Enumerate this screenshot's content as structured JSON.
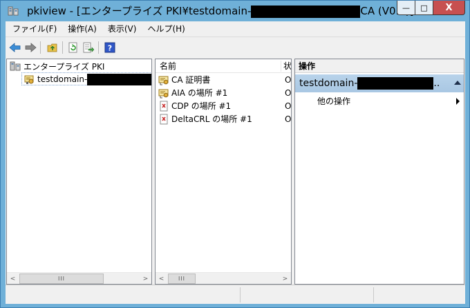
{
  "window": {
    "title_prefix": "pkiview - [エンタープライズ PKI¥testdomain-",
    "title_suffix": "CA (V0.0)]",
    "minimize_glyph": "—",
    "maximize_glyph": "□",
    "close_glyph": "X"
  },
  "menu": {
    "items": [
      "ファイル(F)",
      "操作(A)",
      "表示(V)",
      "ヘルプ(H)"
    ]
  },
  "tree": {
    "root_label": "エンタープライズ PKI",
    "child_label": "testdomain-"
  },
  "list": {
    "col_name": "名前",
    "col_status": "状",
    "rows": [
      {
        "name": "CA 証明書",
        "status": "O",
        "icon": "ca-certificate-icon"
      },
      {
        "name": "AIA の場所 #1",
        "status": "O",
        "icon": "ca-certificate-icon"
      },
      {
        "name": "CDP の場所 #1",
        "status": "O",
        "icon": "crl-icon"
      },
      {
        "name": "DeltaCRL の場所 #1",
        "status": "O",
        "icon": "crl-icon"
      }
    ]
  },
  "actions": {
    "header": "操作",
    "section_title": "testdomain-",
    "section_suffix": "..",
    "item": "他の操作"
  },
  "scroll": {
    "thumb_glyph": "III",
    "left_arrow": "<",
    "right_arrow": ">"
  },
  "colors": {
    "titlebar": "#6fb0d8",
    "action_header": "#b8d3ea",
    "close_button": "#c75050"
  }
}
